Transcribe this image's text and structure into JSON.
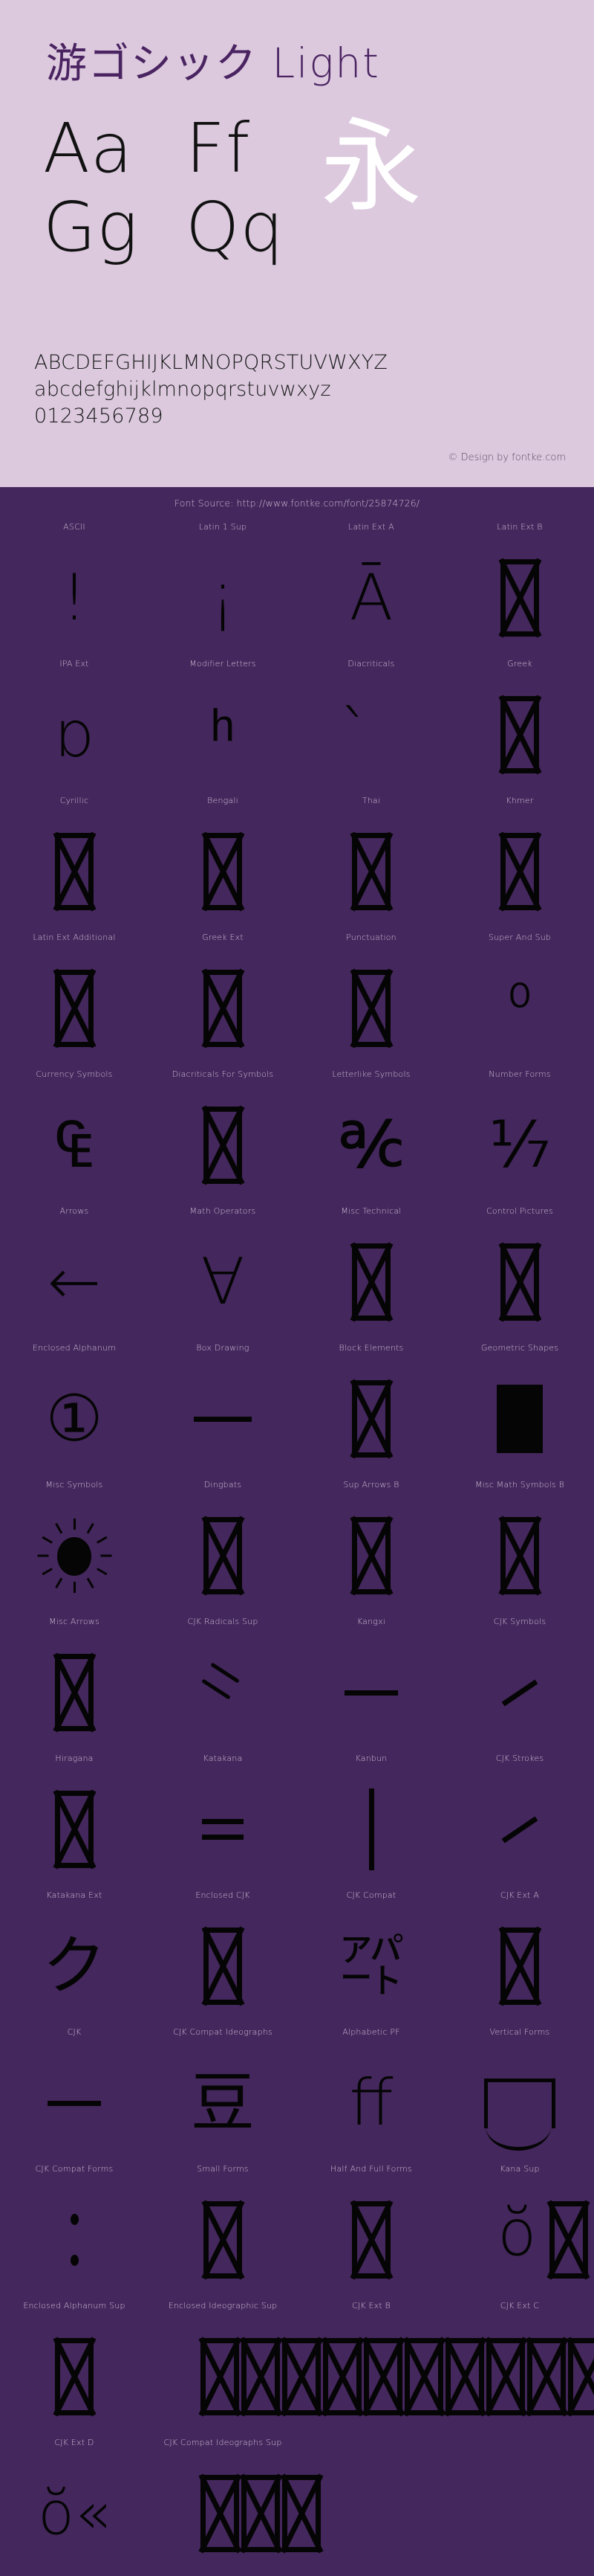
{
  "header": {
    "title": "游ゴシック Light",
    "showcase": {
      "row1": [
        "Aa",
        "Ff"
      ],
      "row2": [
        "Gg",
        "Qq"
      ],
      "kanji": "永"
    },
    "alphabet": {
      "uppercase": "ABCDEFGHIJKLMNOPQRSTUVWXYZ",
      "lowercase": "abcdefghijklmnopqrstuvwxyz",
      "digits": "0123456789"
    },
    "design_credit": "© Design by fontke.com"
  },
  "body": {
    "font_source": "Font Source: http://www.fontke.com/font/25874726/"
  },
  "colors": {
    "header_background": "#dcc9de",
    "body_background": "#44275c",
    "title_text": "#4a2361",
    "glyph_black": "#050505",
    "kanji_white": "#ffffff",
    "label_text": "#cbbbd6"
  },
  "unicode_blocks": [
    {
      "label": "ASCII",
      "glyph": "!",
      "kind": "text"
    },
    {
      "label": "Latin 1 Sup",
      "glyph": "¡",
      "kind": "text"
    },
    {
      "label": "Latin Ext A",
      "glyph": "Ā",
      "kind": "text"
    },
    {
      "label": "Latin Ext B",
      "glyph": "",
      "kind": "tofu"
    },
    {
      "label": "IPA Ext",
      "glyph": "ɒ",
      "kind": "text"
    },
    {
      "label": "Modifier Letters",
      "glyph": "ʰ",
      "kind": "text"
    },
    {
      "label": "Diacriticals",
      "glyph": "̀",
      "kind": "text"
    },
    {
      "label": "Greek",
      "glyph": "",
      "kind": "tofu"
    },
    {
      "label": "Cyrillic",
      "glyph": "",
      "kind": "tofu"
    },
    {
      "label": "Bengali",
      "glyph": "",
      "kind": "tofu"
    },
    {
      "label": "Thai",
      "glyph": "",
      "kind": "tofu"
    },
    {
      "label": "Khmer",
      "glyph": "",
      "kind": "tofu"
    },
    {
      "label": "Latin Ext Additional",
      "glyph": "",
      "kind": "tofu"
    },
    {
      "label": "Greek Ext",
      "glyph": "",
      "kind": "tofu"
    },
    {
      "label": "Punctuation",
      "glyph": "",
      "kind": "tofu"
    },
    {
      "label": "Super And Sub",
      "glyph": "⁰",
      "kind": "text"
    },
    {
      "label": "Currency Symbols",
      "glyph": "₠",
      "kind": "text"
    },
    {
      "label": "Diacriticals For Symbols",
      "glyph": "",
      "kind": "tofu"
    },
    {
      "label": "Letterlike Symbols",
      "glyph": "℀",
      "kind": "text"
    },
    {
      "label": "Number Forms",
      "glyph": "⅐",
      "kind": "text"
    },
    {
      "label": "Arrows",
      "glyph": "←",
      "kind": "text"
    },
    {
      "label": "Math Operators",
      "glyph": "∀",
      "kind": "text"
    },
    {
      "label": "Misc Technical",
      "glyph": "",
      "kind": "tofu"
    },
    {
      "label": "Control Pictures",
      "glyph": "",
      "kind": "tofu"
    },
    {
      "label": "Enclosed Alphanum",
      "glyph": "①",
      "kind": "text"
    },
    {
      "label": "Box Drawing",
      "glyph": "─",
      "kind": "hbar"
    },
    {
      "label": "Block Elements",
      "glyph": "",
      "kind": "tofu"
    },
    {
      "label": "Geometric Shapes",
      "glyph": "■",
      "kind": "square"
    },
    {
      "label": "Misc Symbols",
      "glyph": "☀",
      "kind": "sun"
    },
    {
      "label": "Dingbats",
      "glyph": "",
      "kind": "tofu"
    },
    {
      "label": "Sup Arrows B",
      "glyph": "",
      "kind": "tofu"
    },
    {
      "label": "Misc Math Symbols B",
      "glyph": "",
      "kind": "tofu"
    },
    {
      "label": "Misc Arrows",
      "glyph": "",
      "kind": "tofu"
    },
    {
      "label": "CJK Radicals Sup",
      "glyph": "⺀",
      "kind": "radicals"
    },
    {
      "label": "Kangxi",
      "glyph": "⼀",
      "kind": "kangxi"
    },
    {
      "label": "CJK Symbols",
      "glyph": "、",
      "kind": "slash"
    },
    {
      "label": "Hiragana",
      "glyph": "",
      "kind": "tofu"
    },
    {
      "label": "Katakana",
      "glyph": "゠",
      "kind": "equals"
    },
    {
      "label": "Kanbun",
      "glyph": "|",
      "kind": "vbar"
    },
    {
      "label": "CJK Strokes",
      "glyph": "㇀",
      "kind": "slash"
    },
    {
      "label": "Katakana Ext",
      "glyph": "ク",
      "kind": "text"
    },
    {
      "label": "Enclosed CJK",
      "glyph": "",
      "kind": "tofu"
    },
    {
      "label": "CJK Compat",
      "glyph": "㌀",
      "kind": "text"
    },
    {
      "label": "CJK Ext A",
      "glyph": "",
      "kind": "tofu"
    },
    {
      "label": "CJK",
      "glyph": "一",
      "kind": "kangxi"
    },
    {
      "label": "CJK Compat Ideographs",
      "glyph": "豆",
      "kind": "text"
    },
    {
      "label": "Alphabetic PF",
      "glyph": "ﬀ",
      "kind": "text"
    },
    {
      "label": "Vertical Forms",
      "glyph": "︐",
      "kind": "vertform"
    },
    {
      "label": "CJK Compat Forms",
      "glyph": "︰",
      "kind": "dots"
    },
    {
      "label": "Small Forms",
      "glyph": "",
      "kind": "tofu"
    },
    {
      "label": "Half And Full Forms",
      "glyph": "",
      "kind": "tofu"
    },
    {
      "label": "Kana Sup",
      "glyph": "",
      "kind": "tofu-overflow"
    },
    {
      "label": "Enclosed Alphanum Sup",
      "glyph": "",
      "kind": "tofu"
    },
    {
      "label": "Enclosed Ideographic Sup",
      "glyph": "",
      "kind": "tofu-overflow-wide"
    },
    {
      "label": "CJK Ext B",
      "glyph": "",
      "kind": "blank"
    },
    {
      "label": "CJK Ext C",
      "glyph": "",
      "kind": "blank"
    },
    {
      "label": "CJK Ext D",
      "glyph": "«",
      "kind": "guillemet"
    },
    {
      "label": "CJK Compat Ideographs Sup",
      "glyph": "",
      "kind": "tofu-triple"
    },
    {
      "label": "",
      "glyph": "",
      "kind": "blank"
    },
    {
      "label": "",
      "glyph": "",
      "kind": "blank"
    }
  ]
}
